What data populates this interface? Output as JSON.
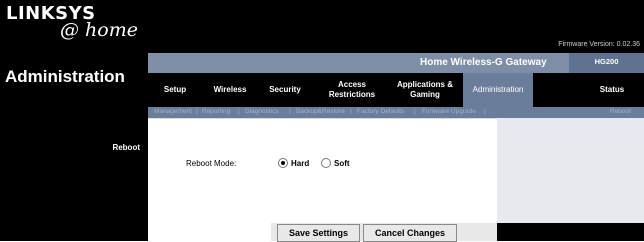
{
  "brand": {
    "name": "LINKSYS",
    "sub": "@ home"
  },
  "firmware": "Firmware Version: 0.02.36",
  "product": {
    "name": "Home Wireless-G Gateway",
    "model": "HG200"
  },
  "section": "Administration",
  "tabs": [
    {
      "label": "Setup"
    },
    {
      "label": "Wireless"
    },
    {
      "label": "Security"
    },
    {
      "label": "Access Restrictions"
    },
    {
      "label": "Applications & Gaming"
    },
    {
      "label": "Administration",
      "active": true
    },
    {
      "label": "Status"
    }
  ],
  "subnav": [
    {
      "label": "Management"
    },
    {
      "label": "Reporting"
    },
    {
      "label": "Diagnostics"
    },
    {
      "label": "Backup&Restore"
    },
    {
      "label": "Factory Defaults"
    },
    {
      "label": "Firmware Upgrade"
    },
    {
      "label": "Reboot",
      "active": true
    }
  ],
  "content": {
    "group_label": "Reboot",
    "mode_label": "Reboot Mode:",
    "options": [
      {
        "label": "Hard",
        "checked": true
      },
      {
        "label": "Soft",
        "checked": false
      }
    ]
  },
  "buttons": {
    "save": "Save Settings",
    "cancel": "Cancel Changes"
  },
  "colors": {
    "header": "#000000",
    "accent": "#6a7e9b",
    "product_bar": "#7d8ea6"
  }
}
